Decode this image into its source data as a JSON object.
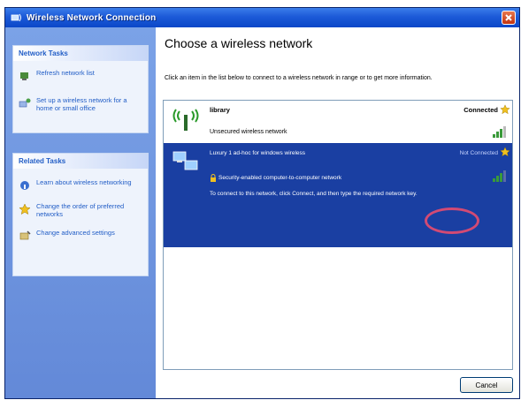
{
  "window": {
    "title": "Wireless Network Connection",
    "title_icon": "wireless-network-icon",
    "close_icon": "close-icon"
  },
  "sidebar": {
    "network_tasks": {
      "header": "Network Tasks",
      "items": [
        {
          "label": "Refresh network list",
          "icon": "refresh-icon"
        },
        {
          "label": "Set up a wireless network for a home or small office",
          "icon": "setup-network-icon"
        }
      ]
    },
    "related_tasks": {
      "header": "Related Tasks",
      "items": [
        {
          "label": "Learn about wireless networking",
          "icon": "info-icon"
        },
        {
          "label": "Change the order of preferred networks",
          "icon": "star-icon"
        },
        {
          "label": "Change advanced settings",
          "icon": "settings-icon"
        }
      ]
    }
  },
  "main": {
    "title": "Choose a wireless network",
    "description": "Click an item in the list below to connect to a wireless network in range or to get more information.",
    "networks": [
      {
        "name": "library",
        "status": "Connected",
        "security": "Unsecured wireless network",
        "signal": 0.8
      },
      {
        "name": "Luxury 1 ad-hoc for windows wireless",
        "status": "Not Connected",
        "security": "Security-enabled computer-to-computer network",
        "message": "To connect to this network, click Connect, and then type the required network key.",
        "signal": 0.8
      }
    ],
    "cancel_label": "Cancel"
  },
  "colors": {
    "titlebar": "#0b47c8",
    "sidebar": "#6a8fdc",
    "selected_row": "#1a3fa2",
    "annotation_circle": "#d24a74"
  }
}
